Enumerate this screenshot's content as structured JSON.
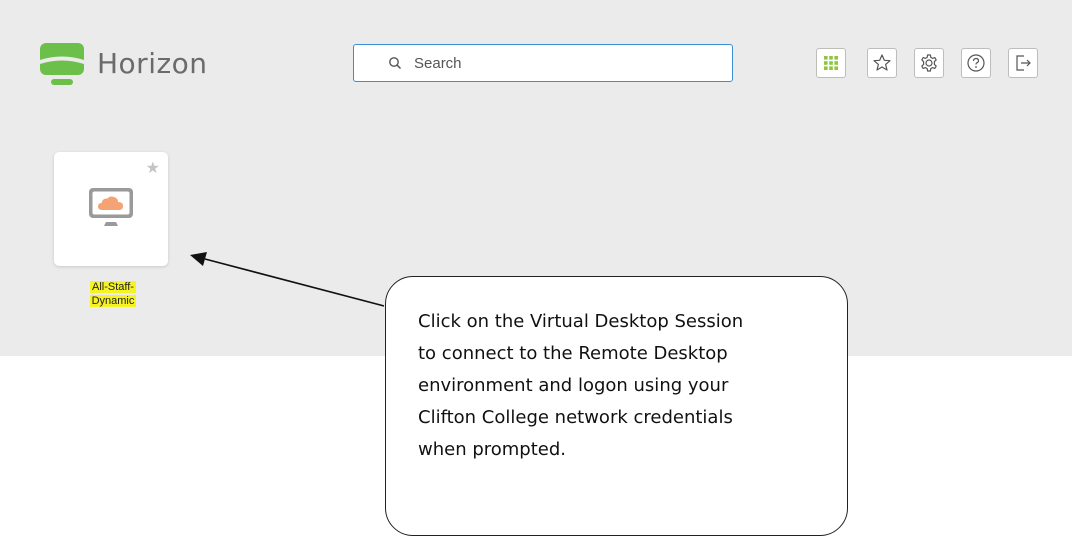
{
  "app": {
    "brand": "Horizon",
    "search": {
      "placeholder": "Search",
      "value": ""
    },
    "toolbar": [
      {
        "icon": "apps-grid-icon"
      },
      {
        "icon": "star-outline-icon"
      },
      {
        "icon": "gear-icon"
      },
      {
        "icon": "help-icon"
      },
      {
        "icon": "logout-icon"
      }
    ],
    "desktops": [
      {
        "name_line1": "All-Staff-",
        "name_line2": "Dynamic",
        "icon": "cloud-desktop-icon",
        "favorite": false
      }
    ]
  },
  "annotation": {
    "lines": [
      "Click on the Virtual Desktop Session",
      "to connect to the Remote Desktop",
      "environment and logon using your",
      "Clifton College network credentials",
      "when prompted."
    ]
  },
  "colors": {
    "app_bg": "#ebebeb",
    "logo_green": "#6cc04a",
    "search_border": "#3a8fd6",
    "apps_icon_green": "#8dc63f",
    "cloud_orange": "#f5a274",
    "highlight": "#f5f226"
  }
}
